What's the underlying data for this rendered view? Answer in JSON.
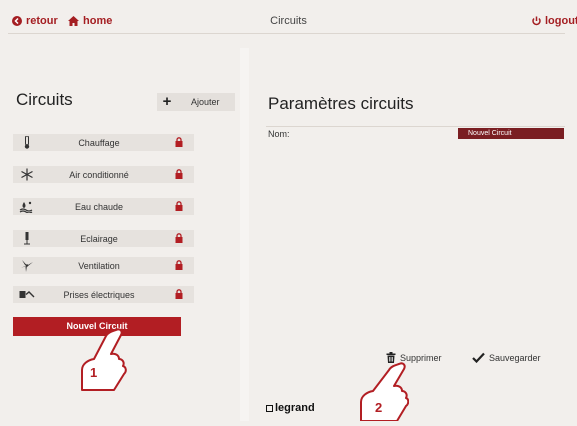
{
  "topbar": {
    "back_label": "retour",
    "home_label": "home",
    "title": "Circuits",
    "logout_label": "logout"
  },
  "left": {
    "title": "Circuits",
    "add_label": "Ajouter",
    "circuits": [
      {
        "label": "Chauffage",
        "icon": "thermometer-icon"
      },
      {
        "label": "Air conditionné",
        "icon": "snowflake-icon"
      },
      {
        "label": "Eau chaude",
        "icon": "water-heater-icon"
      },
      {
        "label": "Eclairage",
        "icon": "lamp-icon"
      },
      {
        "label": "Ventilation",
        "icon": "fan-icon"
      },
      {
        "label": "Prises électriques",
        "icon": "plug-icon"
      }
    ],
    "new_circuit_label": "Nouvel Circuit"
  },
  "right": {
    "title": "Paramètres circuits",
    "name_label": "Nom:",
    "name_value": "Nouvel Circuit",
    "delete_label": "Supprimer",
    "save_label": "Sauvegarder"
  },
  "brand": "legrand",
  "annotations": {
    "one": "1",
    "two": "2"
  },
  "colors": {
    "accent": "#b21e23",
    "background": "#f2efec",
    "row": "#e6e2de"
  }
}
